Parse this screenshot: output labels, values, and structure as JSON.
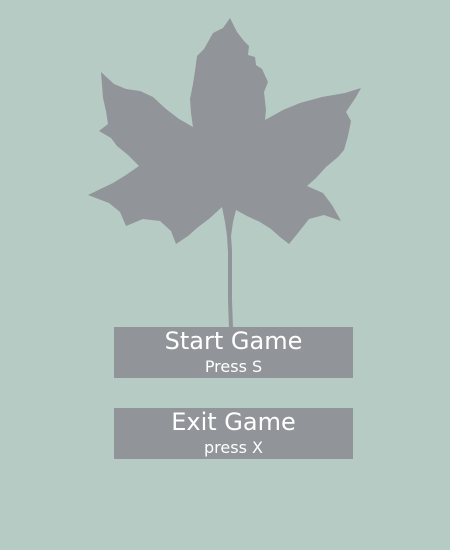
{
  "menu": {
    "start_title": "Start Game",
    "start_hint": "Press S",
    "exit_title": "Exit Game",
    "exit_hint": "press X"
  },
  "colors": {
    "background": "#b6cbc4",
    "leaf": "#919498",
    "button": "#919498",
    "text": "#ffffff"
  },
  "icons": {
    "leaf": "maple-leaf-icon"
  }
}
